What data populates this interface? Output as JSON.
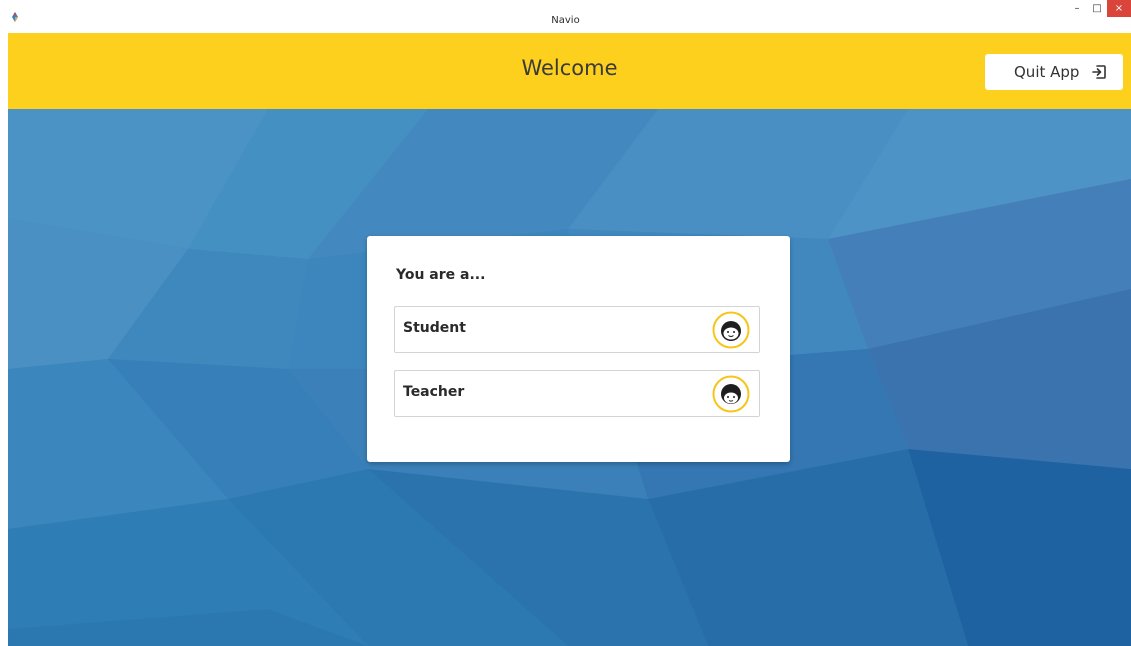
{
  "window": {
    "title": "Navio",
    "controls": {
      "minimize": "–",
      "maximize": "□",
      "close": "×"
    }
  },
  "header": {
    "title": "Welcome",
    "quit_label": "Quit App",
    "quit_icon": "exit-icon",
    "background_color": "#fdd01e"
  },
  "card": {
    "heading": "You are a...",
    "options": [
      {
        "label": "Student",
        "icon": "student-avatar-icon"
      },
      {
        "label": "Teacher",
        "icon": "teacher-avatar-icon"
      }
    ]
  },
  "colors": {
    "accent_yellow": "#fdd01e",
    "background_blue": "#3d86bd",
    "close_red": "#d9453a"
  }
}
